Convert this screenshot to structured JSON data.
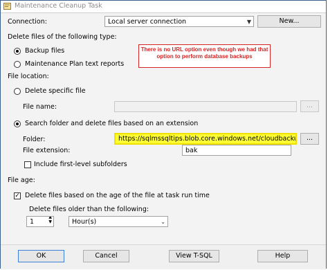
{
  "window": {
    "title": "Maintenance Cleanup Task"
  },
  "connection": {
    "label": "Connection:",
    "value": "Local server connection",
    "new_button": "New..."
  },
  "file_type": {
    "header": "Delete files of the following type:",
    "options": [
      "Backup files",
      "Maintenance Plan text reports"
    ],
    "selected": "Backup files"
  },
  "annotation": {
    "text": "There is no URL option even though we had that option to perform database backups"
  },
  "file_location": {
    "header": "File location:",
    "delete_specific": "Delete specific file",
    "file_name_label": "File name:",
    "file_name_value": "",
    "browse_label": "...",
    "search_folder": "Search folder and delete files based on an extension",
    "folder_label": "Folder:",
    "folder_value": "https://sqlmssqltips.blob.core.windows.net/cloudbacku",
    "extension_label": "File extension:",
    "extension_value": "bak",
    "include_subfolders": "Include first-level subfolders"
  },
  "file_age": {
    "header": "File age:",
    "delete_by_age": "Delete files based on the age of the file at task run time",
    "older_than_label": "Delete files older than the following:",
    "amount": "1",
    "unit": "Hour(s)"
  },
  "buttons": {
    "ok": "OK",
    "cancel": "Cancel",
    "view_tsql": "View T-SQL",
    "help": "Help"
  }
}
